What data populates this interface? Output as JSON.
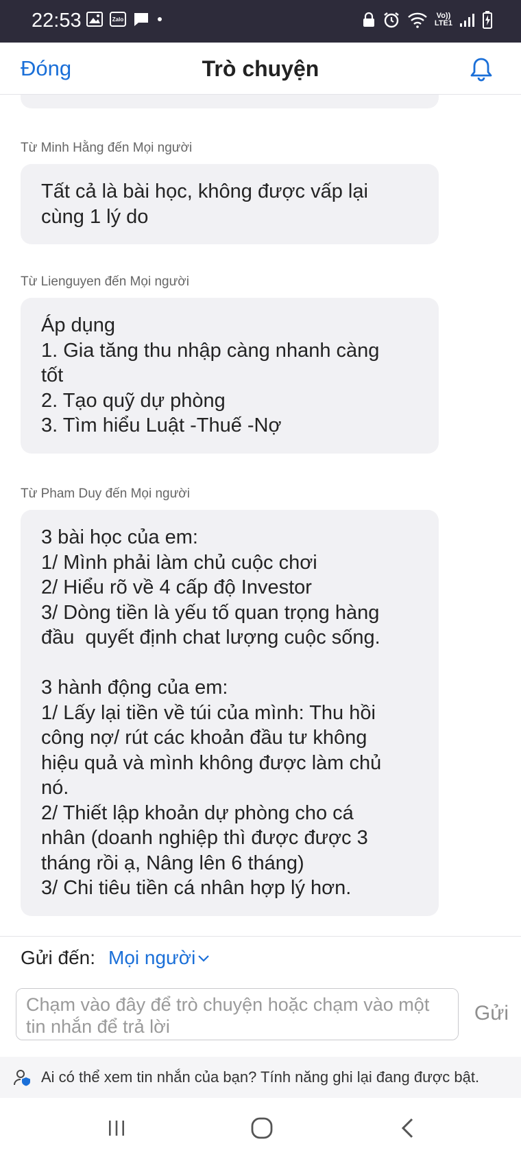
{
  "status_bar": {
    "time": "22:53",
    "zalo_label": "Zalo",
    "network_label_top": "Vo))",
    "network_label_bottom": "LTE1"
  },
  "header": {
    "close_label": "Đóng",
    "title": "Trò chuyện"
  },
  "messages": [
    {
      "sender_line": "Từ Minh Hằng đến Mọi người",
      "text": "Tất cả là bài học, không được vấp lại\ncùng 1 lý do"
    },
    {
      "sender_line": "Từ Lienguyen đến Mọi người",
      "text": "Áp dụng\n1. Gia tăng thu nhập càng nhanh càng\ntốt\n2. Tạo quỹ dự phòng\n3. Tìm hiểu Luật -Thuế -Nợ"
    },
    {
      "sender_line": "Từ Pham Duy đến Mọi người",
      "text": "3 bài học của em:\n1/ Mình phải làm chủ cuộc chơi\n2/ Hiểu rõ về 4 cấp độ Investor\n3/ Dòng tiền là yếu tố quan trọng hàng\nđầu  quyết định chat lượng cuộc sống.\n\n3 hành động của em:\n1/ Lấy lại tiền về túi của mình: Thu hồi\ncông nợ/ rút các khoản đầu tư không\nhiệu quả và mình không được làm chủ\nnó.\n2/ Thiết lập khoản dự phòng cho cá\nnhân (doanh nghiệp thì được được 3\ntháng rồi ạ, Nâng lên 6 tháng)\n3/ Chi tiêu tiền cá nhân hợp lý hơn."
    }
  ],
  "composer": {
    "send_to_label": "Gửi đến:",
    "send_to_target": "Mọi người",
    "input_placeholder": "Chạm vào đây để trò chuyện hoặc chạm vào một tin nhắn để trả lời",
    "send_label": "Gửi"
  },
  "notice": {
    "text": "Ai có thể xem tin nhắn của bạn? Tính năng ghi lại đang được bật."
  },
  "colors": {
    "accent": "#1a6fd8",
    "status_bar_bg": "#2d2b3a",
    "bubble_bg": "#f1f1f4"
  }
}
